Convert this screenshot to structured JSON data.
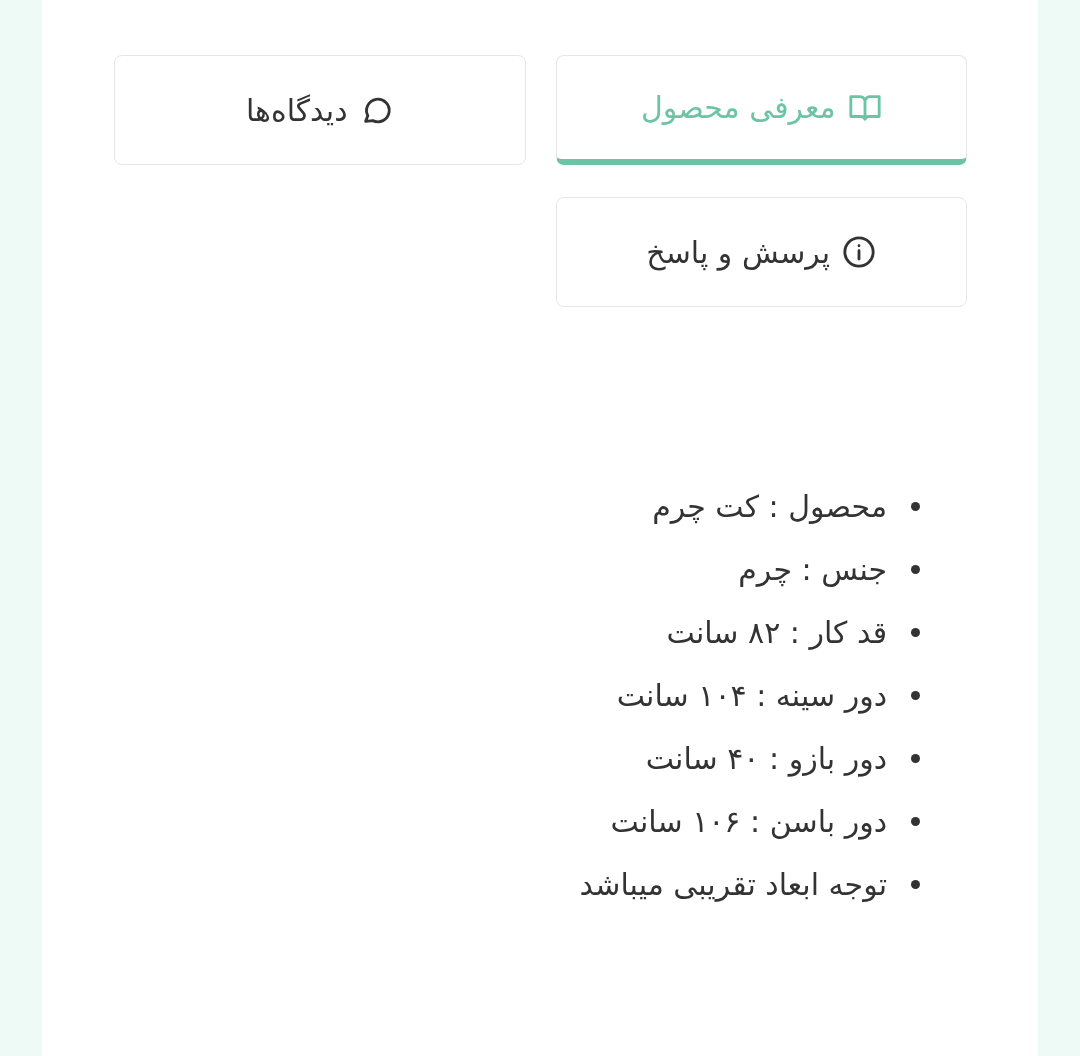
{
  "tabs": [
    {
      "label": "معرفی محصول",
      "kind": "intro",
      "selected": true
    },
    {
      "label": "دیدگاه‌ها",
      "kind": "comments",
      "selected": false
    },
    {
      "label": "پرسش و پاسخ",
      "kind": "questions",
      "selected": false
    }
  ],
  "details": [
    "محصول : کت چرم",
    "جنس : چرم",
    "قد کار : ۸۲ سانت",
    "دور سینه : ۱۰۴ سانت",
    "دور بازو : ۴۰ سانت",
    "دور باسن : ۱۰۶ سانت",
    "توجه ابعاد تقریبی میباشد"
  ]
}
